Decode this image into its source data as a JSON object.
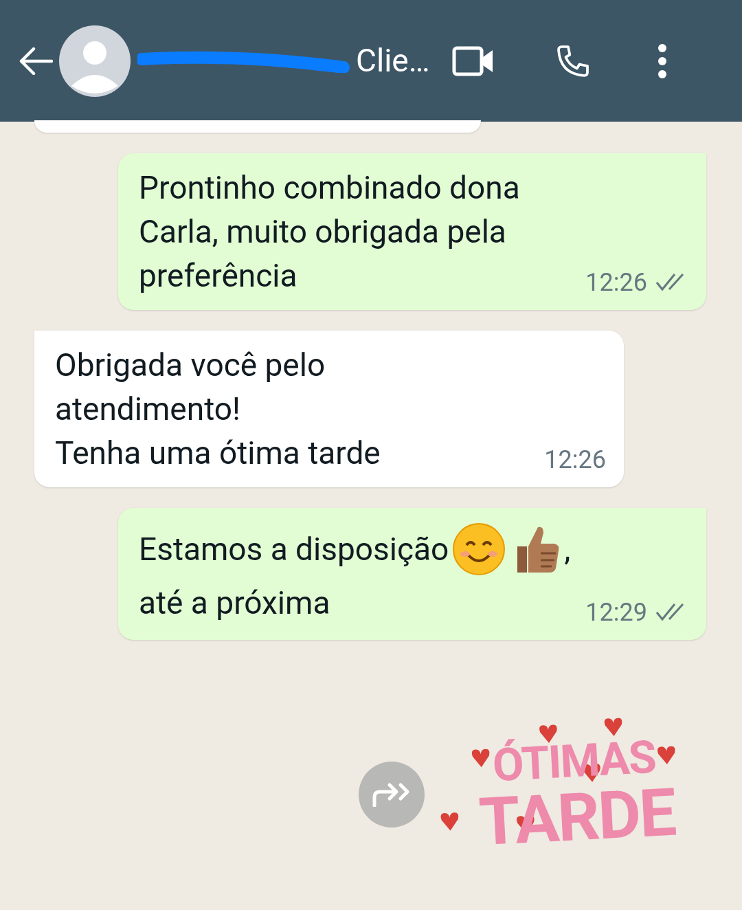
{
  "header": {
    "title": "Clie…"
  },
  "messages": [
    {
      "incoming": true,
      "kind": "stub"
    },
    {
      "incoming": false,
      "kind": "plain",
      "text": "Prontinho combinado dona\nCarla, muito obrigada pela\npreferência",
      "time": "12:26",
      "read": false
    },
    {
      "incoming": true,
      "kind": "plain",
      "text": "Obrigada você pelo\natendimento!\nTenha uma ótima tarde",
      "time": "12:26"
    },
    {
      "incoming": false,
      "kind": "rich",
      "lines": [
        [
          {
            "kind": "text",
            "text": "Estamos a disposição"
          },
          {
            "kind": "smiley"
          },
          {
            "kind": "thumbsup"
          },
          {
            "kind": "text",
            "text": ","
          }
        ],
        [
          {
            "kind": "text",
            "text": "até a próxima"
          }
        ]
      ],
      "time": "12:29",
      "read": false
    },
    {
      "kind": "sticker",
      "lines": [
        "ÓTIMAS",
        "TARDE"
      ]
    }
  ]
}
